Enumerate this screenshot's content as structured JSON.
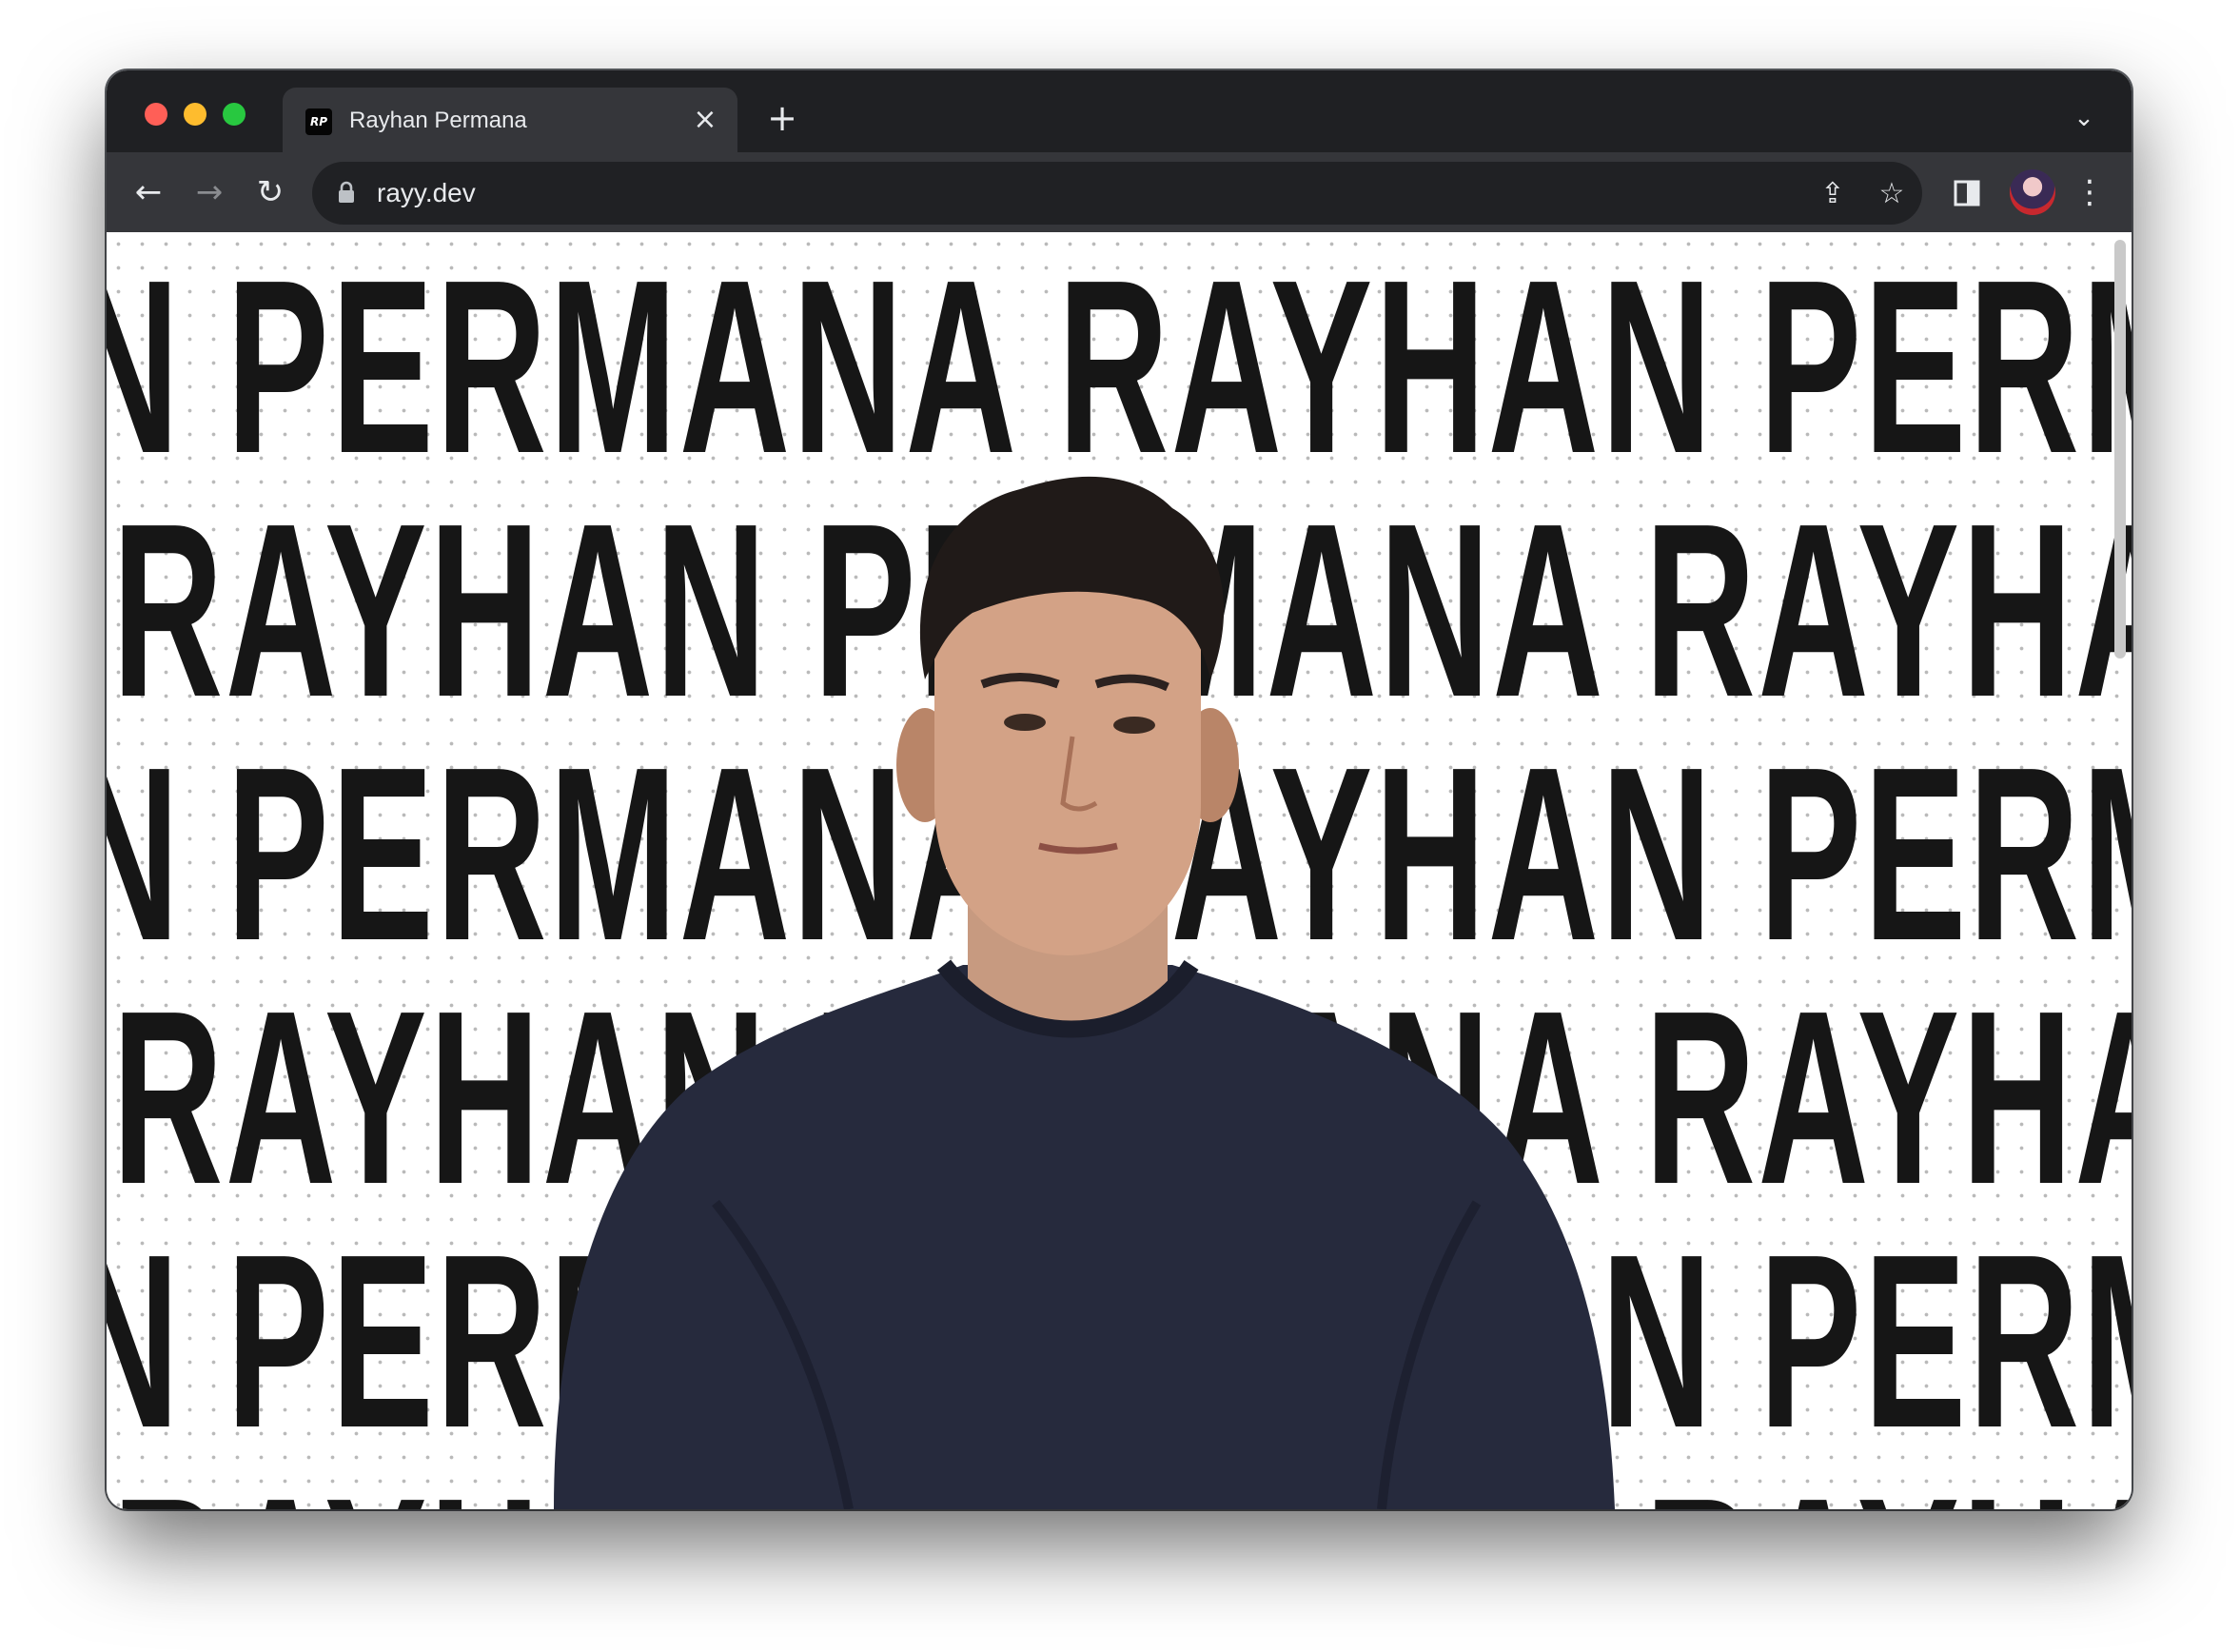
{
  "browser": {
    "tab": {
      "title": "Rayhan Permana",
      "favicon_text": "RP"
    },
    "address": {
      "url": "rayy.dev"
    }
  },
  "page": {
    "rows": [
      "N PERMANA RAYHAN PERMANA RAYHAN",
      "RAYHAN PERMANA RAYHAN PERMANA",
      "N PERMANA RAYHAN PERMANA RAYHAN",
      "RAYHAN PERMANA RAYHAN PERMANA",
      "N PERMANA RAYHAN PERMANA RAYHAN",
      "RAYHAN PERMANA RAYHAN PERMANA"
    ]
  },
  "icons": {
    "back": "back-arrow-icon",
    "forward": "forward-arrow-icon",
    "reload": "reload-icon",
    "lock": "lock-icon",
    "share": "share-icon",
    "bookmark": "star-icon",
    "sidebar": "side-panel-icon",
    "menu": "kebab-menu-icon"
  },
  "colors": {
    "titlebar": "#1f2023",
    "toolbar": "#35363a",
    "omnibox": "#202124",
    "text_dark": "#161616",
    "sweater": "#262a3d"
  }
}
